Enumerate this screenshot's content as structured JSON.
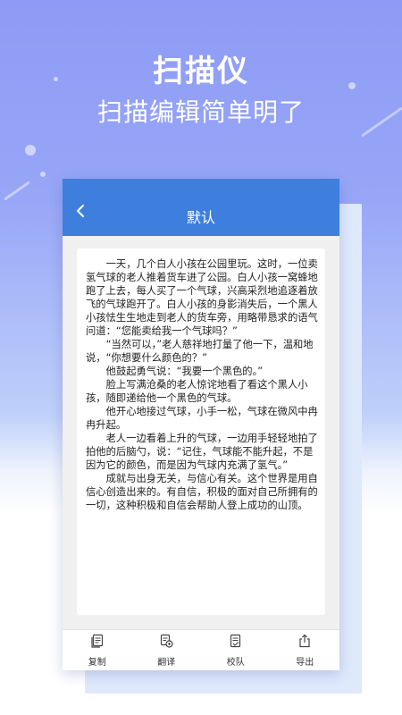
{
  "hero": {
    "title": "扫描仪",
    "subtitle": "扫描编辑简单明了"
  },
  "app": {
    "title": "默认",
    "back_icon": "chevron-left-icon",
    "accent_color": "#3e7fde"
  },
  "document": {
    "paragraphs": [
      "一天，几个白人小孩在公园里玩。这时，一位卖氢气球的老人推着货车进了公园。白人小孩一窝蜂地跑了上去，每人买了一个气球，兴高采烈地追逐着放飞的气球跑开了。白人小孩的身影消失后，一个黑人小孩怯生生地走到老人的货车旁，用略带恳求的语气问道：“您能卖给我一个气球吗？”",
      "“当然可以，”老人慈祥地打量了他一下，温和地说，“你想要什么颜色的？”",
      "他鼓起勇气说：“我要一个黑色的。”",
      "脸上写满沧桑的老人惊诧地看了看这个黑人小孩，随即递给他一个黑色的气球。",
      "他开心地接过气球，小手一松，气球在微风中冉冉升起。",
      "老人一边看着上升的气球，一边用手轻轻地拍了拍他的后脑勺，说：“记住，气球能不能升起，不是因为它的颜色，而是因为气球内充满了氢气。”",
      "成就与出身无关，与信心有关。这个世界是用自信心创造出来的。有自信，积极的面对自己所拥有的一切，这种积极和自信会帮助人登上成功的山顶。"
    ]
  },
  "bottom_bar": {
    "items": [
      {
        "label": "复制",
        "icon": "copy-icon"
      },
      {
        "label": "翻译",
        "icon": "translate-icon"
      },
      {
        "label": "校队",
        "icon": "proofread-icon"
      },
      {
        "label": "导出",
        "icon": "export-icon"
      }
    ]
  }
}
